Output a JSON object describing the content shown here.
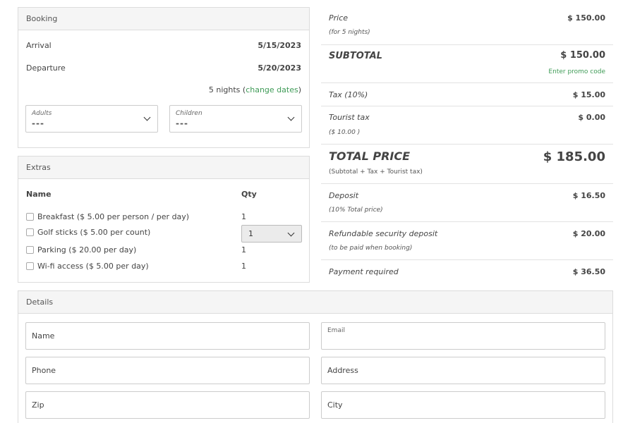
{
  "booking": {
    "title": "Booking",
    "arrival_label": "Arrival",
    "arrival_value": "5/15/2023",
    "departure_label": "Departure",
    "departure_value": "5/20/2023",
    "nights_text": "5 nights (",
    "change_dates": "change dates",
    "nights_close": ")",
    "adults": {
      "label": "Adults",
      "value": "---"
    },
    "children": {
      "label": "Children",
      "value": "---"
    }
  },
  "extras": {
    "title": "Extras",
    "col_name": "Name",
    "col_qty": "Qty",
    "items": [
      {
        "name": "Breakfast ($ 5.00 per person / per day)",
        "qty": "1"
      },
      {
        "name": "Golf sticks ($ 5.00 per count)",
        "qty": "1"
      },
      {
        "name": "Parking ($ 20.00 per day)",
        "qty": "1"
      },
      {
        "name": "Wi-fi access ($ 5.00 per day)",
        "qty": "1"
      }
    ]
  },
  "summary": {
    "price_label": "Price",
    "price_value": "$ 150.00",
    "price_note": "(for 5 nights)",
    "subtotal_label": "SUBTOTAL",
    "subtotal_value": "$ 150.00",
    "promo_link": "Enter promo code",
    "tax_label": "Tax (10%)",
    "tax_value": "$ 15.00",
    "tourist_label": "Tourist tax",
    "tourist_value": "$ 0.00",
    "tourist_note": "($ 10.00 )",
    "total_label": "TOTAL PRICE",
    "total_value": "$ 185.00",
    "total_note": "(Subtotal + Tax + Tourist tax)",
    "deposit_label": "Deposit",
    "deposit_value": "$ 16.50",
    "deposit_note": "(10% Total price)",
    "security_label": "Refundable security deposit",
    "security_value": "$ 20.00",
    "security_note": "(to be paid when booking)",
    "payment_label": "Payment required",
    "payment_value": "$ 36.50"
  },
  "details": {
    "title": "Details",
    "name_placeholder": "Name",
    "email_label": "Email",
    "phone_placeholder": "Phone",
    "address_placeholder": "Address",
    "zip_placeholder": "Zip",
    "city_placeholder": "City"
  },
  "colors": {
    "accent": "#3f9b57",
    "panel_header": "#f5f5f5",
    "border": "#dcdcdc"
  }
}
